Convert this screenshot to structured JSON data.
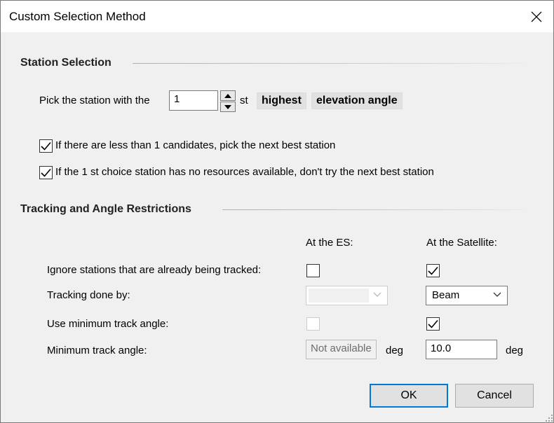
{
  "window": {
    "title": "Custom Selection Method"
  },
  "station_selection": {
    "heading": "Station Selection",
    "pick_label": "Pick the station with the",
    "rank_value": "1",
    "rank_suffix": "st",
    "criterion": "highest",
    "attribute": "elevation angle",
    "option_candidates": {
      "checked": true,
      "label": "If there are less than 1 candidates, pick the next best station"
    },
    "option_resources": {
      "checked": true,
      "label": "If the 1 st choice station has no resources available, don't try the next best station"
    }
  },
  "tracking": {
    "heading": "Tracking and Angle Restrictions",
    "col_es": "At the ES:",
    "col_sat": "At the Satellite:",
    "rows": {
      "ignore_tracked": {
        "label": "Ignore stations that are already being tracked:",
        "es_checked": false,
        "sat_checked": true
      },
      "tracking_done_by": {
        "label": "Tracking done by:",
        "es_value": "",
        "sat_value": "Beam"
      },
      "use_min_angle": {
        "label": "Use minimum track angle:",
        "es_checked": false,
        "sat_checked": true
      },
      "min_angle": {
        "label": "Minimum track angle:",
        "es_value": "Not available",
        "es_unit": "deg",
        "sat_value": "10.0",
        "sat_unit": "deg"
      }
    }
  },
  "buttons": {
    "ok": "OK",
    "cancel": "Cancel"
  },
  "icons": {
    "close": "close-icon",
    "spin_up": "arrow-up-icon",
    "spin_down": "arrow-down-icon",
    "check": "checkmark-icon",
    "dropdown": "chevron-down-icon",
    "grip": "resize-grip-icon"
  },
  "colors": {
    "default_button_border": "#0078d7",
    "dialog_bg": "#f0f0f0"
  }
}
